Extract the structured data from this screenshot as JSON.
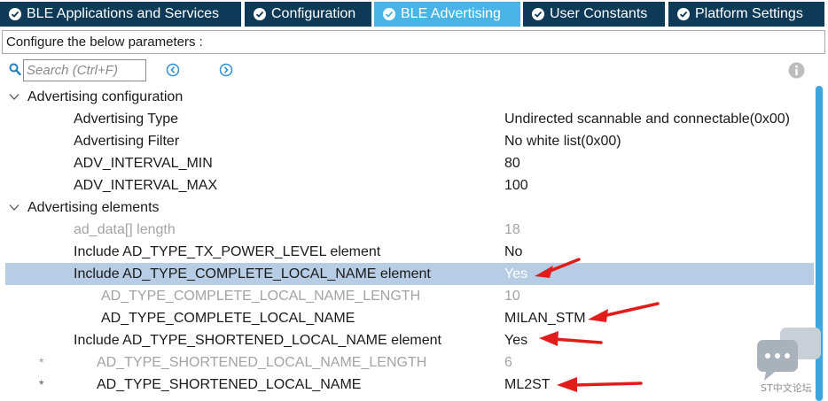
{
  "tabs": [
    {
      "label": "BLE Applications and Services",
      "active": false
    },
    {
      "label": "Configuration",
      "active": false
    },
    {
      "label": "BLE Advertising",
      "active": true
    },
    {
      "label": "User Constants",
      "active": false
    },
    {
      "label": "Platform Settings",
      "active": false
    }
  ],
  "info_text": "Configure the below parameters :",
  "search": {
    "placeholder": "Search (Ctrl+F)"
  },
  "tree": {
    "advertising_configuration": {
      "label": "Advertising configuration",
      "rows": [
        {
          "label": "Advertising Type",
          "value": "Undirected scannable and connectable(0x00)"
        },
        {
          "label": "Advertising Filter",
          "value": "No white list(0x00)"
        },
        {
          "label": "ADV_INTERVAL_MIN",
          "value": "80"
        },
        {
          "label": "ADV_INTERVAL_MAX",
          "value": "100"
        }
      ]
    },
    "advertising_elements": {
      "label": "Advertising elements",
      "rows": [
        {
          "label": "ad_data[] length",
          "value": "18"
        },
        {
          "label": "Include AD_TYPE_TX_POWER_LEVEL element",
          "value": "No"
        },
        {
          "label": "Include AD_TYPE_COMPLETE_LOCAL_NAME element",
          "value": "Yes"
        },
        {
          "label": "AD_TYPE_COMPLETE_LOCAL_NAME_LENGTH",
          "value": "10"
        },
        {
          "label": "AD_TYPE_COMPLETE_LOCAL_NAME",
          "value": "MILAN_STM"
        },
        {
          "label": "Include AD_TYPE_SHORTENED_LOCAL_NAME  element",
          "value": "Yes"
        },
        {
          "label": "AD_TYPE_SHORTENED_LOCAL_NAME_LENGTH",
          "value": "6",
          "marker": "*"
        },
        {
          "label": "AD_TYPE_SHORTENED_LOCAL_NAME",
          "value": "ML2ST",
          "marker": "*"
        }
      ]
    }
  },
  "watermark": {
    "text": "ST中文论坛"
  },
  "colors": {
    "tab_bg": "#0f3a57",
    "tab_active_bg": "#48b5e6",
    "selected_row_bg": "#b7cde5",
    "dim_text": "#a3a3a3",
    "arrow": "#e21b1b",
    "scrollbar": "#3ea6dc"
  },
  "icons": {
    "tab_check": "check-circle-icon",
    "search": "search-icon",
    "nav_prev": "chevron-left-circle-icon",
    "nav_next": "chevron-right-circle-icon",
    "info": "info-icon",
    "expand": "chevron-down-icon",
    "watermark": "chat-bubble-icon"
  }
}
